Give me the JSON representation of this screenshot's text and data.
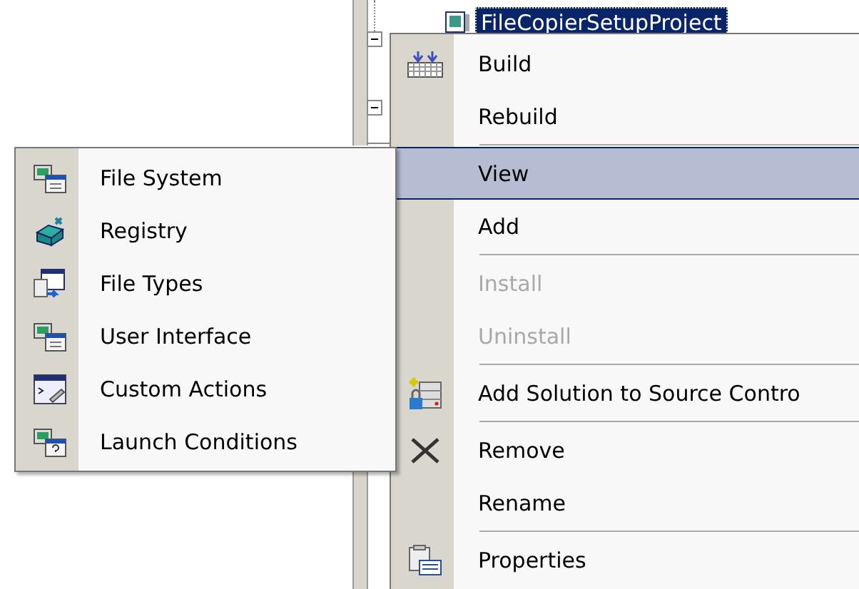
{
  "tree": {
    "node": {
      "label": "FileCopierSetupProject",
      "selected": true
    }
  },
  "context_menu": {
    "items": [
      {
        "kind": "build",
        "label": "Build",
        "disabled": false,
        "selected": false
      },
      {
        "kind": "command",
        "label": "Rebuild",
        "disabled": false,
        "selected": false
      },
      {
        "kind": "separator"
      },
      {
        "kind": "command",
        "label": "View",
        "disabled": false,
        "selected": true
      },
      {
        "kind": "command",
        "label": "Add",
        "disabled": false,
        "selected": false
      },
      {
        "kind": "separator"
      },
      {
        "kind": "command",
        "label": "Install",
        "disabled": true,
        "selected": false
      },
      {
        "kind": "command",
        "label": "Uninstall",
        "disabled": true,
        "selected": false
      },
      {
        "kind": "separator"
      },
      {
        "kind": "source",
        "label": "Add Solution to Source Contro",
        "disabled": false,
        "selected": false
      },
      {
        "kind": "separator"
      },
      {
        "kind": "remove",
        "label": "Remove",
        "disabled": false,
        "selected": false
      },
      {
        "kind": "command",
        "label": "Rename",
        "disabled": false,
        "selected": false
      },
      {
        "kind": "separator"
      },
      {
        "kind": "properties",
        "label": "Properties",
        "disabled": false,
        "selected": false
      }
    ]
  },
  "submenu": {
    "items": [
      {
        "kind": "filesystem",
        "label": "File System"
      },
      {
        "kind": "registry",
        "label": "Registry"
      },
      {
        "kind": "filetypes",
        "label": "File Types"
      },
      {
        "kind": "ui",
        "label": "User Interface"
      },
      {
        "kind": "custom",
        "label": "Custom Actions"
      },
      {
        "kind": "launch",
        "label": "Launch Conditions"
      }
    ]
  }
}
